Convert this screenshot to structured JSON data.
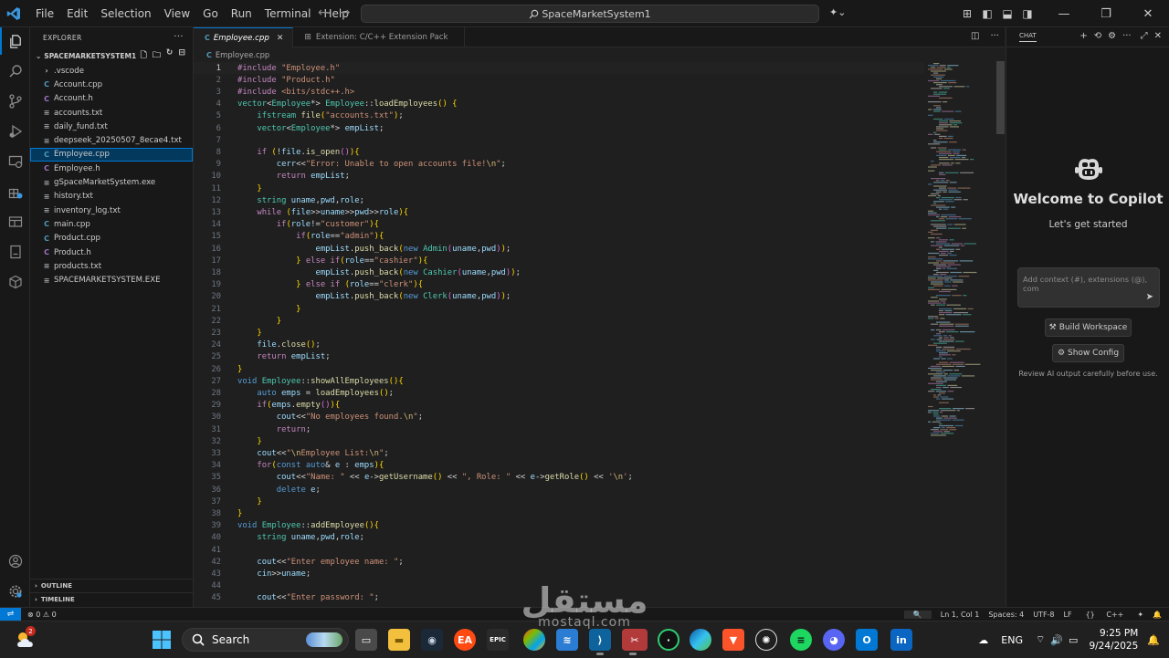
{
  "titlebar": {
    "menu": [
      "File",
      "Edit",
      "Selection",
      "View",
      "Go",
      "Run",
      "Terminal",
      "Help"
    ],
    "search": "SpaceMarketSystem1"
  },
  "explorer": {
    "title": "EXPLORER",
    "project": "SPACEMARKETSYSTEM1",
    "files": [
      {
        "name": ".vscode",
        "type": "folder"
      },
      {
        "name": "Account.cpp",
        "type": "cpp"
      },
      {
        "name": "Account.h",
        "type": "h"
      },
      {
        "name": "accounts.txt",
        "type": "txt"
      },
      {
        "name": "daily_fund.txt",
        "type": "txt"
      },
      {
        "name": "deepseek_20250507_8ecae4.txt",
        "type": "txt"
      },
      {
        "name": "Employee.cpp",
        "type": "cpp",
        "selected": true
      },
      {
        "name": "Employee.h",
        "type": "h"
      },
      {
        "name": "gSpaceMarketSystem.exe",
        "type": "exe"
      },
      {
        "name": "history.txt",
        "type": "txt"
      },
      {
        "name": "inventory_log.txt",
        "type": "txt"
      },
      {
        "name": "main.cpp",
        "type": "cpp"
      },
      {
        "name": "Product.cpp",
        "type": "cpp"
      },
      {
        "name": "Product.h",
        "type": "h"
      },
      {
        "name": "products.txt",
        "type": "txt"
      },
      {
        "name": "SPACEMARKETSYSTEM.EXE",
        "type": "exe"
      }
    ],
    "outline": "OUTLINE",
    "timeline": "TIMELINE"
  },
  "editor": {
    "tabs": [
      {
        "label": "Employee.cpp",
        "active": true
      },
      {
        "label": "Extension: C/C++ Extension Pack",
        "active": false
      }
    ],
    "breadcrumb": "Employee.cpp",
    "lines": [
      "#include \"Employee.h\"",
      "#include \"Product.h\"",
      "#include <bits/stdc++.h>",
      "vector<Employee*> Employee::loadEmployees() {",
      "    ifstream file(\"accounts.txt\");",
      "    vector<Employee*> empList;",
      "",
      "    if (!file.is_open()){",
      "        cerr<<\"Error: Unable to open accounts file!\\n\";",
      "        return empList;",
      "    }",
      "    string uname,pwd,role;",
      "    while (file>>uname>>pwd>>role){",
      "        if(role!=\"customer\"){",
      "            if(role==\"admin\"){",
      "                empList.push_back(new Admin(uname,pwd));",
      "            } else if(role==\"cashier\"){",
      "                empList.push_back(new Cashier(uname,pwd));",
      "            } else if (role==\"clerk\"){",
      "                empList.push_back(new Clerk(uname,pwd));",
      "            }",
      "        }",
      "    }",
      "    file.close();",
      "    return empList;",
      "}",
      "void Employee::showAllEmployees(){",
      "    auto emps = loadEmployees();",
      "    if(emps.empty()){",
      "        cout<<\"No employees found.\\n\";",
      "        return;",
      "    }",
      "    cout<<\"\\nEmployee List:\\n\";",
      "    for(const auto& e : emps){",
      "        cout<<\"Name: \" << e->getUsername() << \", Role: \" << e->getRole() << '\\n';",
      "        delete e;",
      "    }",
      "}",
      "void Employee::addEmployee(){",
      "    string uname,pwd,role;",
      "",
      "    cout<<\"Enter employee name: \";",
      "    cin>>uname;",
      "",
      "    cout<<\"Enter password: \";"
    ]
  },
  "chat": {
    "title": "CHAT",
    "welcome": "Welcome to Copilot",
    "subtitle": "Let's get started",
    "input_placeholder": "Add context (#), extensions (@), com",
    "build_button": "Build Workspace",
    "config_button": "Show Config",
    "review_note": "Review AI output carefully before use."
  },
  "statusbar": {
    "problems": "0",
    "warnings": "0",
    "position": "Ln 1, Col 1",
    "spaces": "Spaces: 4",
    "encoding": "UTF-8",
    "eol": "LF",
    "language": "C++"
  },
  "taskbar": {
    "search": "Search",
    "weather_badge": "2",
    "language": "ENG",
    "time": "9:25 PM",
    "date": "9/24/2025"
  },
  "watermark": {
    "arabic": "مستقل",
    "latin": "mostaql.com"
  },
  "colors": {
    "accent": "#0078d4",
    "selection": "#04395e",
    "background": "#1f1f1f"
  }
}
